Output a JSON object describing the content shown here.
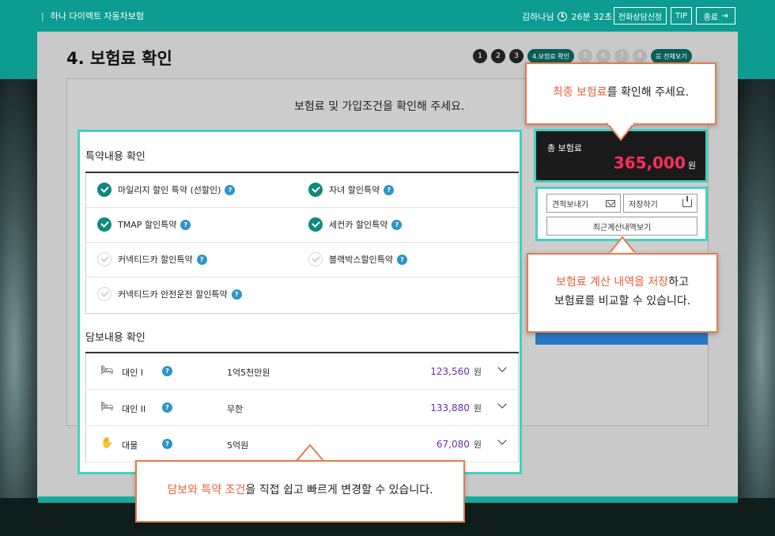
{
  "header": {
    "brand": "하나 다이렉트 자동차보험",
    "user_time": "김하나님",
    "timer": "26분 32초",
    "buttons": {
      "consult": "전화상담신청",
      "tip": "TIP",
      "exit": "종료"
    }
  },
  "page": {
    "title": "4. 보험료 확인",
    "heading": "보험료 및 가입조건을 확인해 주세요.",
    "steps": [
      "1",
      "2",
      "3",
      "4.보험료 확인",
      "5",
      "6",
      "7",
      "8"
    ],
    "view_all": "전체보기"
  },
  "special_terms": {
    "title": "특약내용 확인",
    "items": [
      {
        "label": "마일리지 할인 특약 (선할인)",
        "checked": true
      },
      {
        "label": "자녀 할인특약",
        "checked": true
      },
      {
        "label": "TMAP 할인특약",
        "checked": true
      },
      {
        "label": "세컨카 할인특약",
        "checked": true
      },
      {
        "label": "커넥티드카 할인특약",
        "checked": false
      },
      {
        "label": "블랙박스할인특약",
        "checked": false
      },
      {
        "label": "커넥티드카 안전운전 할인특약",
        "checked": false
      }
    ],
    "help": "?"
  },
  "coverage": {
    "title": "담보내용 확인",
    "rows": [
      {
        "icon": "person-injury-icon",
        "name": "대인 I",
        "limit": "1억5천만원",
        "amount": "123,560",
        "unit": "원"
      },
      {
        "icon": "person-injury-icon",
        "name": "대인 II",
        "limit": "무한",
        "amount": "133,880",
        "unit": "원"
      },
      {
        "icon": "property-icon",
        "name": "대물",
        "limit": "5억원",
        "amount": "67,080",
        "unit": "원"
      }
    ]
  },
  "total": {
    "label": "총 보험료",
    "amount": "365,000",
    "unit": "원"
  },
  "save": {
    "quote_send": "견적보내기",
    "save": "저장하기",
    "recent": "최근계산내역보기"
  },
  "callouts": {
    "top": {
      "highlight": "최종 보험료",
      "rest": "를 확인해 주세요."
    },
    "right": {
      "highlight": "보험료 계산 내역을 저장",
      "rest": "하고",
      "line2": "보험료를 비교할 수 있습니다."
    },
    "bottom": {
      "highlight": "담보와 특약 조건",
      "rest": "을 직접 쉽고 빠르게 변경할 수 있습니다."
    }
  },
  "colors": {
    "teal": "#0d9c91",
    "highlight_border": "#44d0c4",
    "callout_border": "#e87a4d",
    "price_red": "#ff2e5b",
    "amount_purple": "#6b2fa3"
  }
}
